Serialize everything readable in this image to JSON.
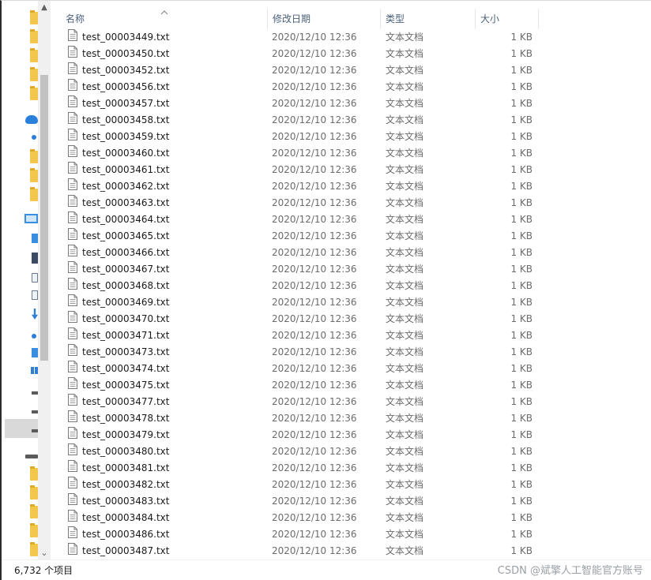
{
  "columns": {
    "name": "名称",
    "date": "修改日期",
    "type": "类型",
    "size": "大小"
  },
  "files": [
    {
      "name": "test_00003449.txt",
      "date": "2020/12/10 12:36",
      "type": "文本文档",
      "size": "1 KB"
    },
    {
      "name": "test_00003450.txt",
      "date": "2020/12/10 12:36",
      "type": "文本文档",
      "size": "1 KB"
    },
    {
      "name": "test_00003452.txt",
      "date": "2020/12/10 12:36",
      "type": "文本文档",
      "size": "1 KB"
    },
    {
      "name": "test_00003456.txt",
      "date": "2020/12/10 12:36",
      "type": "文本文档",
      "size": "1 KB"
    },
    {
      "name": "test_00003457.txt",
      "date": "2020/12/10 12:36",
      "type": "文本文档",
      "size": "1 KB"
    },
    {
      "name": "test_00003458.txt",
      "date": "2020/12/10 12:36",
      "type": "文本文档",
      "size": "1 KB"
    },
    {
      "name": "test_00003459.txt",
      "date": "2020/12/10 12:36",
      "type": "文本文档",
      "size": "1 KB"
    },
    {
      "name": "test_00003460.txt",
      "date": "2020/12/10 12:36",
      "type": "文本文档",
      "size": "1 KB"
    },
    {
      "name": "test_00003461.txt",
      "date": "2020/12/10 12:36",
      "type": "文本文档",
      "size": "1 KB"
    },
    {
      "name": "test_00003462.txt",
      "date": "2020/12/10 12:36",
      "type": "文本文档",
      "size": "1 KB"
    },
    {
      "name": "test_00003463.txt",
      "date": "2020/12/10 12:36",
      "type": "文本文档",
      "size": "1 KB"
    },
    {
      "name": "test_00003464.txt",
      "date": "2020/12/10 12:36",
      "type": "文本文档",
      "size": "1 KB"
    },
    {
      "name": "test_00003465.txt",
      "date": "2020/12/10 12:36",
      "type": "文本文档",
      "size": "1 KB"
    },
    {
      "name": "test_00003466.txt",
      "date": "2020/12/10 12:36",
      "type": "文本文档",
      "size": "1 KB"
    },
    {
      "name": "test_00003467.txt",
      "date": "2020/12/10 12:36",
      "type": "文本文档",
      "size": "1 KB"
    },
    {
      "name": "test_00003468.txt",
      "date": "2020/12/10 12:36",
      "type": "文本文档",
      "size": "1 KB"
    },
    {
      "name": "test_00003469.txt",
      "date": "2020/12/10 12:36",
      "type": "文本文档",
      "size": "1 KB"
    },
    {
      "name": "test_00003470.txt",
      "date": "2020/12/10 12:36",
      "type": "文本文档",
      "size": "1 KB"
    },
    {
      "name": "test_00003471.txt",
      "date": "2020/12/10 12:36",
      "type": "文本文档",
      "size": "1 KB"
    },
    {
      "name": "test_00003473.txt",
      "date": "2020/12/10 12:36",
      "type": "文本文档",
      "size": "1 KB"
    },
    {
      "name": "test_00003474.txt",
      "date": "2020/12/10 12:36",
      "type": "文本文档",
      "size": "1 KB"
    },
    {
      "name": "test_00003475.txt",
      "date": "2020/12/10 12:36",
      "type": "文本文档",
      "size": "1 KB"
    },
    {
      "name": "test_00003477.txt",
      "date": "2020/12/10 12:36",
      "type": "文本文档",
      "size": "1 KB"
    },
    {
      "name": "test_00003478.txt",
      "date": "2020/12/10 12:36",
      "type": "文本文档",
      "size": "1 KB"
    },
    {
      "name": "test_00003479.txt",
      "date": "2020/12/10 12:36",
      "type": "文本文档",
      "size": "1 KB"
    },
    {
      "name": "test_00003480.txt",
      "date": "2020/12/10 12:36",
      "type": "文本文档",
      "size": "1 KB"
    },
    {
      "name": "test_00003481.txt",
      "date": "2020/12/10 12:36",
      "type": "文本文档",
      "size": "1 KB"
    },
    {
      "name": "test_00003482.txt",
      "date": "2020/12/10 12:36",
      "type": "文本文档",
      "size": "1 KB"
    },
    {
      "name": "test_00003483.txt",
      "date": "2020/12/10 12:36",
      "type": "文本文档",
      "size": "1 KB"
    },
    {
      "name": "test_00003484.txt",
      "date": "2020/12/10 12:36",
      "type": "文本文档",
      "size": "1 KB"
    },
    {
      "name": "test_00003486.txt",
      "date": "2020/12/10 12:36",
      "type": "文本文档",
      "size": "1 KB"
    },
    {
      "name": "test_00003487.txt",
      "date": "2020/12/10 12:36",
      "type": "文本文档",
      "size": "1 KB"
    }
  ],
  "status": {
    "item_count": "6,732 个项目"
  },
  "watermark": "CSDN @斌擎人工智能官方账号",
  "icons": {
    "file": "text-file-icon",
    "sort": "sort-ascending-icon"
  },
  "colors": {
    "header_text": "#4c607a",
    "secondary_text": "#6b6b6b",
    "folder": "#f3c74b",
    "accent": "#2a7fdb"
  }
}
